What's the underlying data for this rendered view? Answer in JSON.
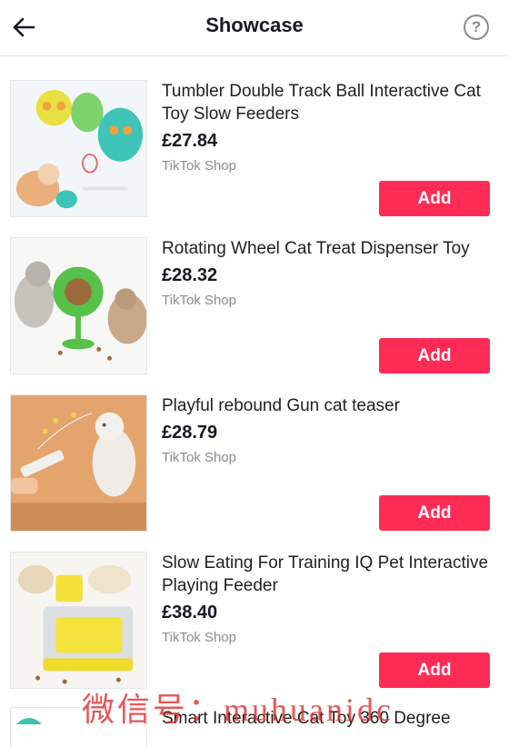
{
  "header": {
    "title": "Showcase",
    "back_icon": "arrow-left-icon",
    "help_icon": "question-circle-icon",
    "help_glyph": "?"
  },
  "products": [
    {
      "title": "Tumbler Double Track Ball Interactive Cat Toy Slow Feeders",
      "price": "£27.84",
      "seller": "TikTok Shop",
      "add_label": "Add"
    },
    {
      "title": "Rotating Wheel Cat Treat Dispenser Toy",
      "price": "£28.32",
      "seller": "TikTok Shop",
      "add_label": "Add"
    },
    {
      "title": "Playful rebound Gun cat teaser",
      "price": "£28.79",
      "seller": "TikTok Shop",
      "add_label": "Add"
    },
    {
      "title": "Slow Eating For Training IQ Pet Interactive Playing Feeder",
      "price": "£38.40",
      "seller": "TikTok Shop",
      "add_label": "Add"
    }
  ],
  "partial_product": {
    "title": "Smart Interactive Cat Toy 360 Degree"
  },
  "watermark": "微信号：muhuanidc",
  "colors": {
    "accent": "#fe2c55",
    "text": "#161823",
    "muted": "#8a8b91",
    "divider": "#e3e3e4"
  }
}
